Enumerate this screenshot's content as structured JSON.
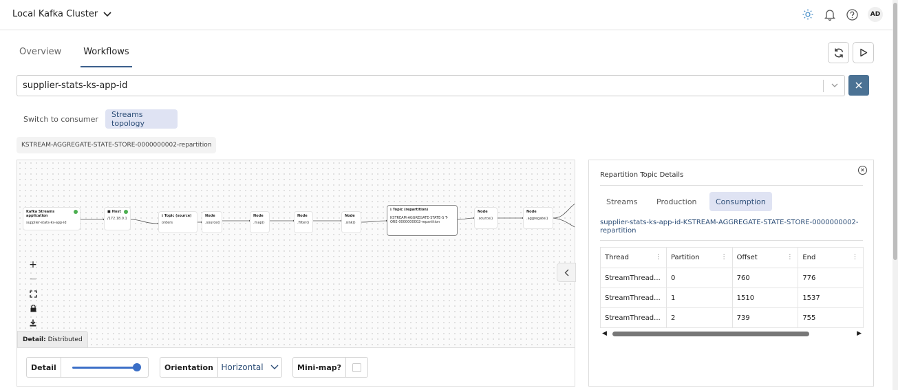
{
  "header": {
    "cluster_name": "Local Kafka Cluster",
    "avatar_initials": "AD"
  },
  "tabs": [
    {
      "label": "Overview",
      "active": false
    },
    {
      "label": "Workflows",
      "active": true
    }
  ],
  "app_select": {
    "value": "supplier-stats-ks-app-id"
  },
  "view_chips": {
    "switch": "Switch to consumer",
    "topology": "Streams topology"
  },
  "breadcrumb": "KSTREAM-AGGREGATE-STATE-STORE-0000000002-repartition",
  "graph": {
    "nodes": {
      "app": {
        "title": "Kafka Streams application",
        "body": "supplier-stats-ks-app-id"
      },
      "host": {
        "title": "Host",
        "body": "/172.18.0.1"
      },
      "source_topic": {
        "title": "Topic (source)",
        "body": "orders"
      },
      "n1": {
        "title": "Node",
        "body": ".source()"
      },
      "n2": {
        "title": "Node",
        "body": ".map()"
      },
      "n3": {
        "title": "Node",
        "body": ".filter()"
      },
      "n4": {
        "title": "Node",
        "body": ".sink()"
      },
      "repart": {
        "title": "Topic (repartition)",
        "body": "KSTREAM-AGGREGATE-STATE-S T- ORE-0000000002-repartition"
      },
      "n5": {
        "title": "Node",
        "body": ".source()"
      },
      "n6": {
        "title": "Node",
        "body": ".aggregate()"
      }
    },
    "detail_badge_label": "Detail:",
    "detail_badge_value": "Distributed"
  },
  "controls": {
    "detail_label": "Detail",
    "detail_level": 1.0,
    "orientation_label": "Orientation",
    "orientation_value": "Horizontal",
    "minimap_label": "Mini-map?",
    "minimap_checked": false
  },
  "panel": {
    "title": "Repartition Topic Details",
    "tabs": [
      "Streams",
      "Production",
      "Consumption"
    ],
    "active_tab": "Consumption",
    "topic": "supplier-stats-ks-app-id-KSTREAM-AGGREGATE-STATE-STORE-0000000002-repartition",
    "columns": [
      "Thread",
      "Partition",
      "Offset",
      "End"
    ],
    "rows": [
      [
        "StreamThread...",
        "0",
        "760",
        "776"
      ],
      [
        "StreamThread...",
        "1",
        "1510",
        "1537"
      ],
      [
        "StreamThread...",
        "2",
        "739",
        "755"
      ]
    ]
  }
}
